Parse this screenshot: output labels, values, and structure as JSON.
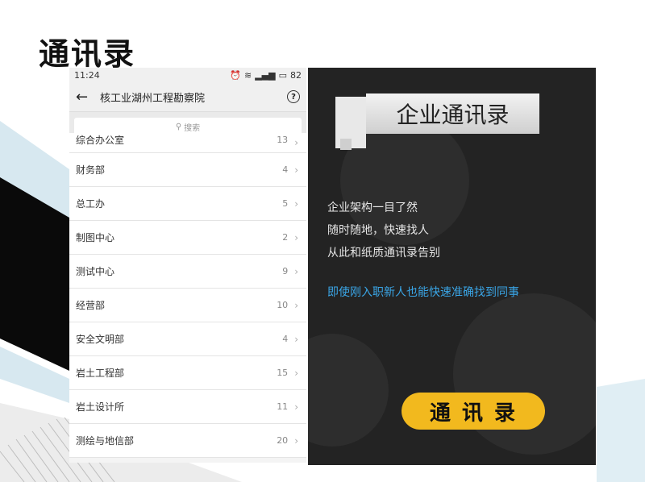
{
  "slide": {
    "title": "通讯录"
  },
  "phone": {
    "status": {
      "time": "11:24",
      "battery": "82"
    },
    "nav": {
      "title": "核工业湖州工程勘察院"
    },
    "search": {
      "placeholder": "搜索"
    },
    "departments": [
      {
        "name": "综合办公室",
        "count": "13"
      },
      {
        "name": "财务部",
        "count": "4"
      },
      {
        "name": "总工办",
        "count": "5"
      },
      {
        "name": "制图中心",
        "count": "2"
      },
      {
        "name": "测试中心",
        "count": "9"
      },
      {
        "name": "经营部",
        "count": "10"
      },
      {
        "name": "安全文明部",
        "count": "4"
      },
      {
        "name": "岩土工程部",
        "count": "15"
      },
      {
        "name": "岩土设计所",
        "count": "11"
      },
      {
        "name": "测绘与地信部",
        "count": "20"
      }
    ]
  },
  "promo": {
    "heading": "企业通讯录",
    "lines": [
      "企业架构一目了然",
      "随时随地，快速找人",
      "从此和纸质通讯录告别"
    ],
    "accent_line": "即使刚入职新人也能快速准确找到同事",
    "pill_label": "通讯录"
  },
  "colors": {
    "accent_blue": "#3aa5e6",
    "pill_yellow": "#f2b91e",
    "panel_dark": "#232323"
  }
}
